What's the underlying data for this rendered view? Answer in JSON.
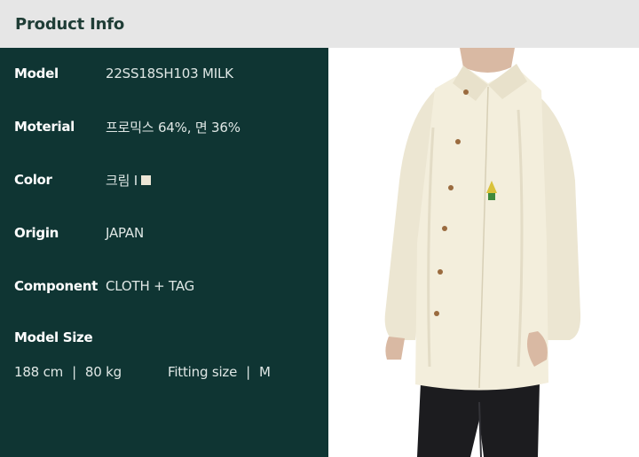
{
  "header": {
    "title": "Product Info"
  },
  "specs": [
    {
      "label": "Model",
      "value": "22SS18SH103 MILK"
    },
    {
      "label": "Moterial",
      "value": "프로믹스 64%, 면 36%"
    },
    {
      "label": "Color",
      "value": "크림 I"
    },
    {
      "label": "Origin",
      "value": "JAPAN"
    },
    {
      "label": "Component",
      "value": "CLOTH + TAG"
    }
  ],
  "model_size": {
    "label": "Model Size",
    "height": "188 cm",
    "divider": "|",
    "weight": "80 kg",
    "fitting_label": "Fitting size",
    "fitting_value": "M"
  },
  "colors": {
    "header_bg": "#e6e6e6",
    "panel_bg": "#0f3533",
    "swatch": "#ece6d6",
    "shirt": "#f3eedc"
  },
  "image": {
    "icon": "product-photo"
  }
}
